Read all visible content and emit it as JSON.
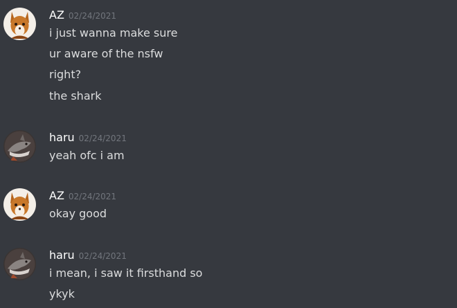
{
  "messages": [
    {
      "author": "AZ",
      "timestamp": "02/24/2021",
      "avatar": "fox-avatar-icon",
      "lines": [
        "i just wanna make sure",
        "ur aware of the nsfw",
        "right?",
        "the shark"
      ]
    },
    {
      "author": "haru",
      "timestamp": "02/24/2021",
      "avatar": "shark-avatar-icon",
      "lines": [
        "yeah ofc i am"
      ]
    },
    {
      "author": "AZ",
      "timestamp": "02/24/2021",
      "avatar": "fox-avatar-icon",
      "lines": [
        "okay good"
      ]
    },
    {
      "author": "haru",
      "timestamp": "02/24/2021",
      "avatar": "shark-avatar-icon",
      "lines": [
        "i mean, i saw it firsthand so",
        "ykyk"
      ]
    }
  ],
  "colors": {
    "background": "#36393f",
    "author": "#ffffff",
    "timestamp": "#72767d",
    "message_text": "#dcddde"
  }
}
